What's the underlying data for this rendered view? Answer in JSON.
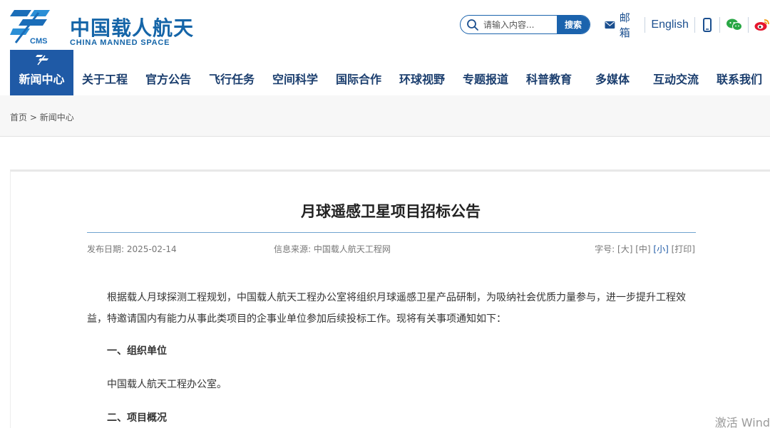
{
  "header": {
    "logo_cn": "中国载人航天",
    "logo_en": "CHINA MANNED SPACE",
    "logo_mark_text": "CMS",
    "search": {
      "placeholder": "请输入内容...",
      "button_label": "搜索"
    },
    "mail_label": "邮箱",
    "english_label": "English",
    "icons": [
      "mobile-icon",
      "wechat-icon",
      "weibo-icon"
    ]
  },
  "nav": {
    "active": "新闻中心",
    "items": [
      "关于工程",
      "官方公告",
      "飞行任务",
      "空间科学",
      "国际合作",
      "环球视野",
      "专题报道",
      "科普教育",
      "多媒体",
      "互动交流",
      "联系我们"
    ]
  },
  "breadcrumb": {
    "home": "首页",
    "separator": ">",
    "current": "新闻中心"
  },
  "article": {
    "title": "月球遥感卫星项目招标公告",
    "date": "发布日期: 2025-02-14",
    "source": "信息来源: 中国载人航天工程网",
    "font_label": "字号:",
    "font_large": "[大]",
    "font_medium": "[中]",
    "font_small": "[小]",
    "print": "[打印]",
    "para1": "根据载人月球探测工程规划，中国载人航天工程办公室将组织月球遥感卫星产品研制，为吸纳社会优质力量参与，进一步提升工程效益，特邀请国内有能力从事此类项目的企事业单位参加后续投标工作。现将有关事项通知如下：",
    "section1_heading": "一、组织单位",
    "section1_text": "中国载人航天工程办公室。",
    "section2_heading": "二、项目概况"
  },
  "watermark": "激活 Wind",
  "colors": {
    "brand_blue": "#1f5aa6",
    "nav_text": "#1b3e6e",
    "rule": "#6fa3cf"
  }
}
